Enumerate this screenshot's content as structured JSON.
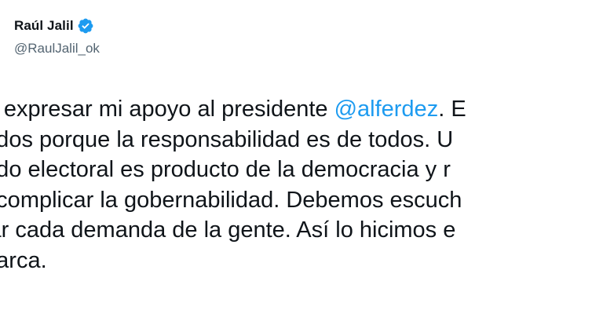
{
  "author": {
    "display_name": "Raúl Jalil",
    "handle": "@RaulJalil_ok",
    "verified_icon": "verified-badge-icon",
    "verified_color": "#1d9bf0"
  },
  "tweet": {
    "lines": [
      {
        "before": "ro expresar mi apoyo al presidente ",
        "mention": "@alferdez",
        "after": ". E"
      },
      {
        "text": "todos porque la responsabilidad es de todos. U"
      },
      {
        "text": "tado electoral es producto de la democracia y r"
      },
      {
        "text": "e complicar la gobernabilidad. Debemos escuch"
      },
      {
        "text": "zar cada demanda de la gente. Así lo hicimos e"
      },
      {
        "text": "marca."
      }
    ]
  },
  "colors": {
    "text": "#0f1419",
    "secondary": "#536471",
    "link": "#1d9bf0"
  }
}
